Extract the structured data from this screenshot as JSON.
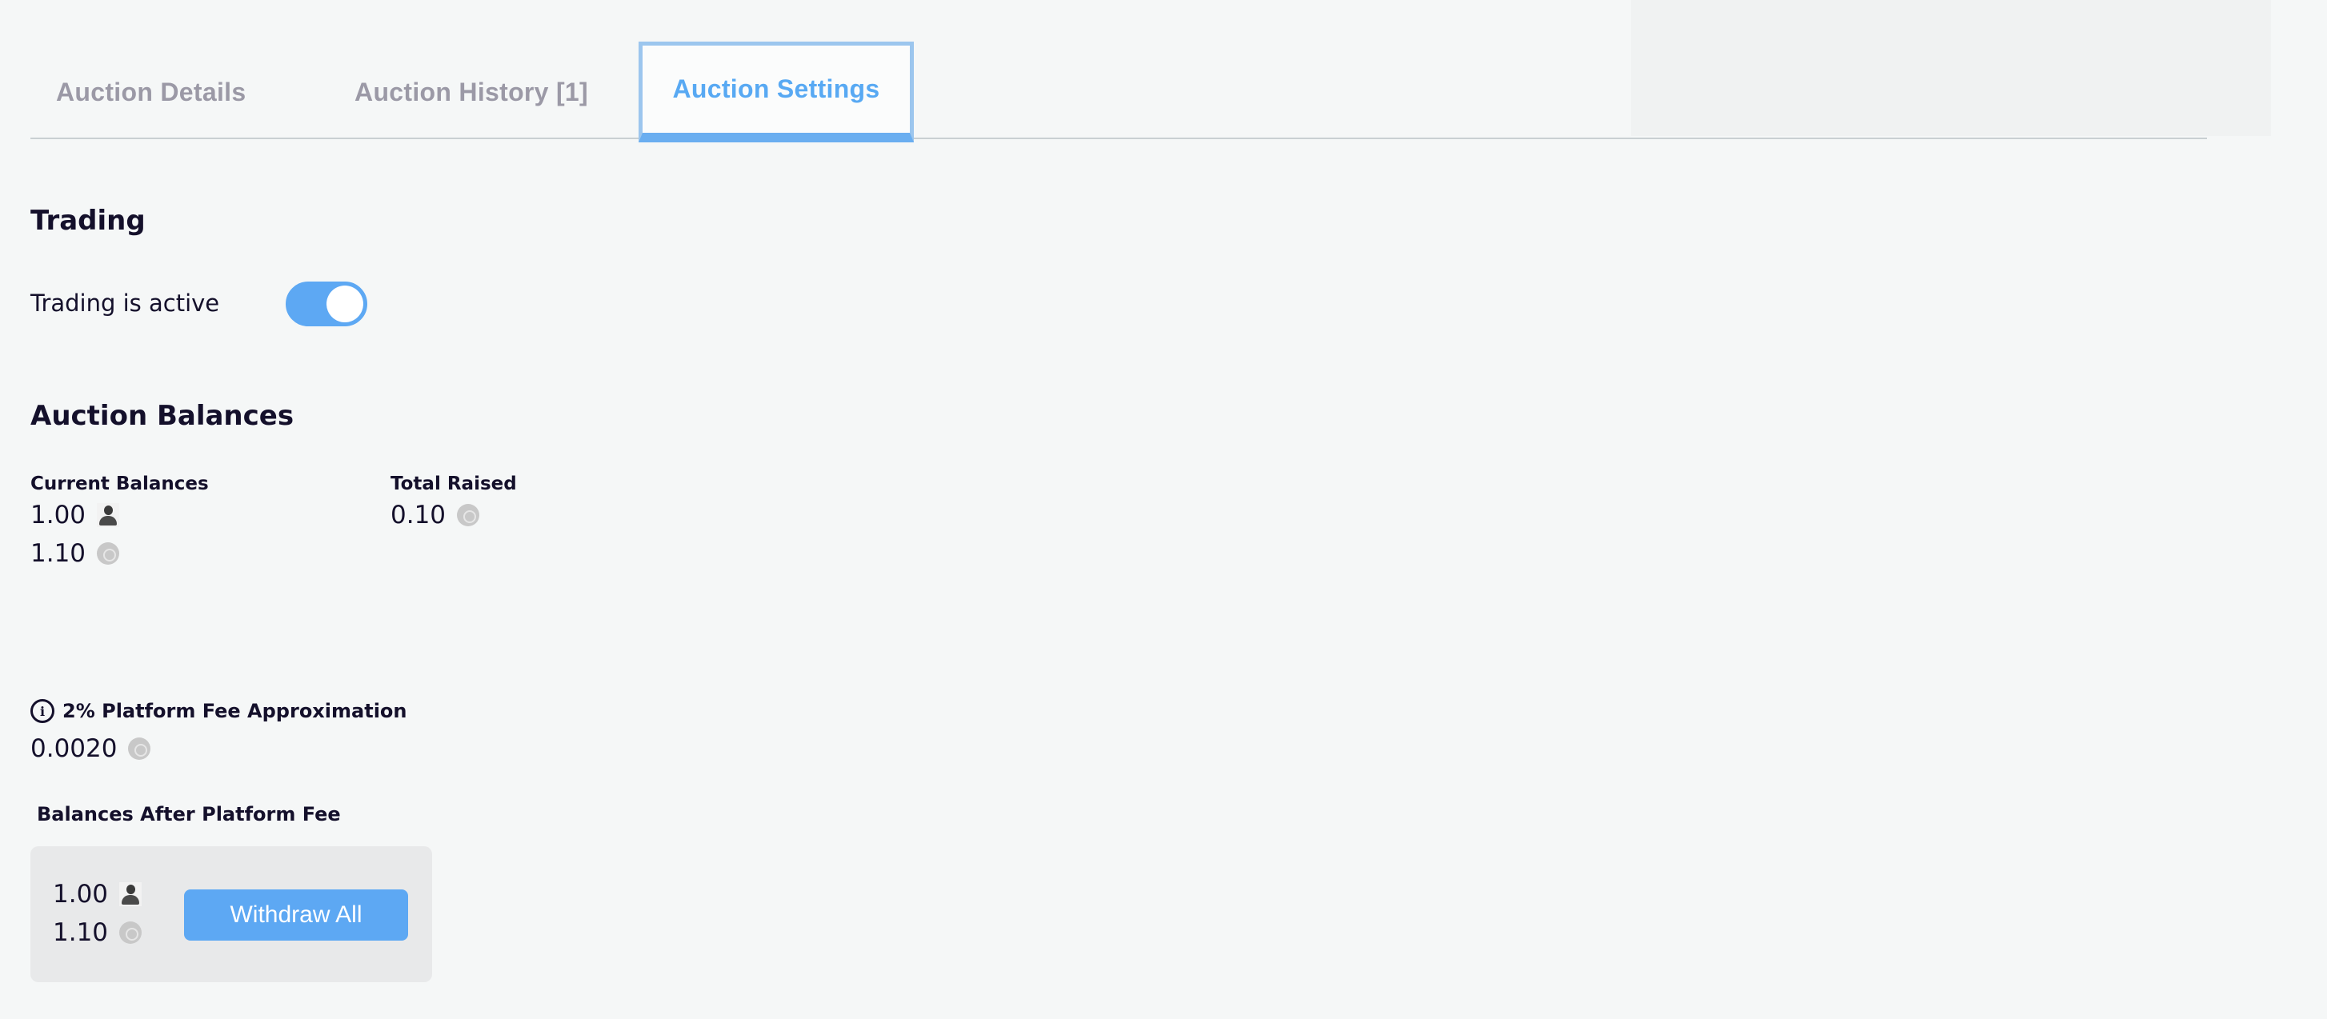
{
  "tabs": {
    "details": "Auction Details",
    "history": "Auction History [1]",
    "settings": "Auction Settings",
    "active": "settings"
  },
  "trading": {
    "heading": "Trading",
    "label": "Trading is active",
    "toggle_on": true
  },
  "balances": {
    "heading": "Auction Balances",
    "current_label": "Current Balances",
    "current": [
      {
        "value": "1.00",
        "icon": "avatar-token-icon"
      },
      {
        "value": "1.10",
        "icon": "coin-icon"
      }
    ],
    "raised_label": "Total Raised",
    "raised": {
      "value": "0.10",
      "icon": "coin-icon"
    }
  },
  "fee": {
    "title": "2% Platform Fee Approximation",
    "value": "0.0020",
    "icon": "coin-icon"
  },
  "after_fee": {
    "title": "Balances After Platform Fee",
    "balances": [
      {
        "value": "1.00",
        "icon": "avatar-token-icon"
      },
      {
        "value": "1.10",
        "icon": "coin-icon"
      }
    ],
    "withdraw_label": "Withdraw All"
  },
  "colors": {
    "accent": "#5da8f3",
    "text": "#14102b",
    "muted_tab": "#9b99a6",
    "background": "#f5f7f7"
  }
}
